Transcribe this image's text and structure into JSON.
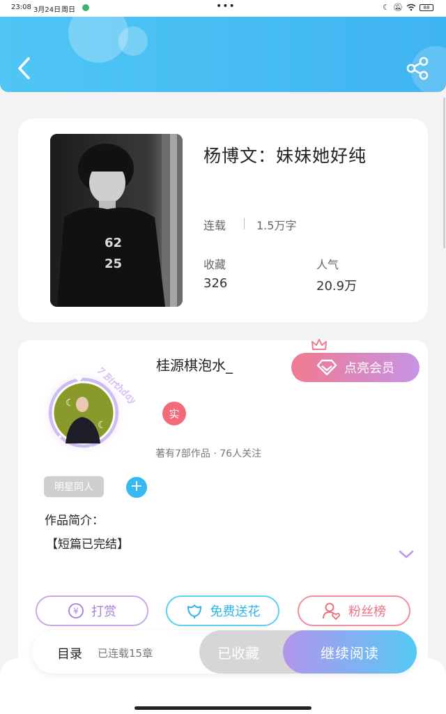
{
  "status_bar": {
    "time": "23:08",
    "date": "3月24日",
    "weekday": "周日",
    "more": "•••",
    "battery": "88"
  },
  "header": {
    "back_icon": "chevron-left-icon",
    "share_icon": "share-icon",
    "color": "#44bdf3"
  },
  "book": {
    "title": "杨博文：妹妹她好纯",
    "status": "连载",
    "words": "1.5万字",
    "favorites_label": "收藏",
    "favorites_value": "326",
    "popularity_label": "人气",
    "popularity_value": "20.9万",
    "cover_text_1": "62",
    "cover_text_2": "25"
  },
  "author": {
    "name": "桂源棋泡水_",
    "vip_button": "点亮会员",
    "real_badge": "实",
    "stats": "著有7部作品 · 76人关注",
    "avatar_frame_text": "7 Birthday",
    "tag": "明星同人",
    "tag_add": "+",
    "intro_title": "作品简介：",
    "intro_text": "【短篇已完结】"
  },
  "actions": {
    "tip": "打赏",
    "flower": "免费送花",
    "fans": "粉丝榜"
  },
  "bottom_bar": {
    "toc": "目录",
    "chapters": "已连载15章",
    "collected": "已收藏",
    "continue": "继续阅读"
  }
}
